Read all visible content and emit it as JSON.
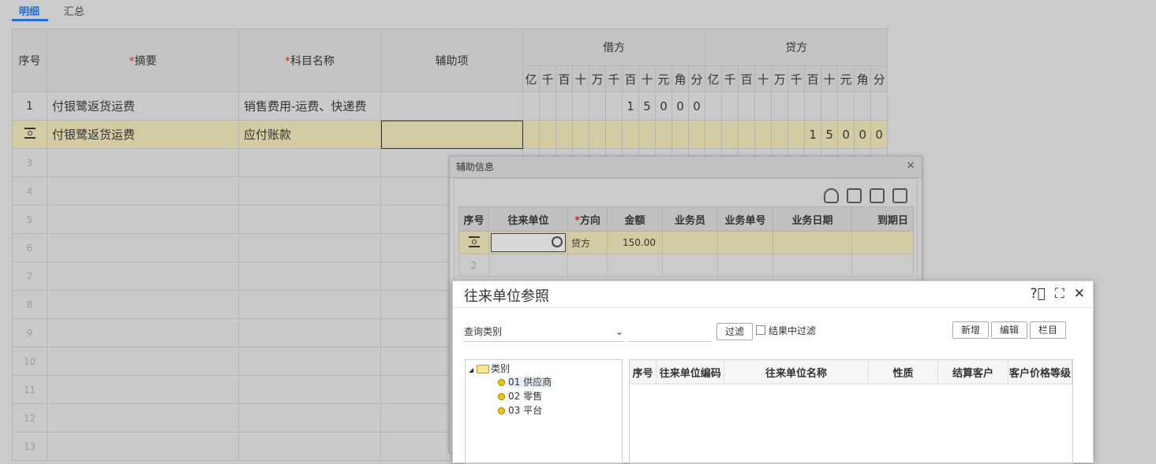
{
  "tabs": [
    {
      "label": "明细",
      "active": true
    },
    {
      "label": "汇总",
      "active": false
    }
  ],
  "main": {
    "headers": {
      "seq": "序号",
      "summary": "摘要",
      "account": "科目名称",
      "aux": "辅助项",
      "debit": "借方",
      "credit": "贷方",
      "required_mark": "*"
    },
    "units": [
      "亿",
      "千",
      "百",
      "十",
      "万",
      "千",
      "百",
      "十",
      "元",
      "角",
      "分"
    ],
    "rows": [
      {
        "seq": "1",
        "summary": "付银鹭返货运费",
        "account": "销售费用-运费、快递费",
        "debit": [
          "",
          "",
          "",
          "",
          "",
          "",
          "1",
          "5",
          "0",
          "0",
          "0"
        ],
        "credit": [
          "",
          "",
          "",
          "",
          "",
          "",
          "",
          "",
          "",
          "",
          ""
        ]
      },
      {
        "seq": "",
        "summary": "付银鹭返货运费",
        "account": "应付账款",
        "debit": [
          "",
          "",
          "",
          "",
          "",
          "",
          "",
          "",
          "",
          "",
          ""
        ],
        "credit": [
          "",
          "",
          "",
          "",
          "",
          "",
          "1",
          "5",
          "0",
          "0",
          "0"
        ]
      }
    ],
    "empty_rows": [
      "3",
      "4",
      "5",
      "6",
      "7",
      "8",
      "9",
      "10",
      "11",
      "12",
      "13"
    ]
  },
  "aux_dialog": {
    "title": "辅助信息",
    "close": "×",
    "headers": [
      "序号",
      "往来单位",
      "方向",
      "金额",
      "业务员",
      "业务单号",
      "业务日期",
      "到期日"
    ],
    "required_mark": "*",
    "rows": [
      {
        "seq": "",
        "unit": "",
        "direction": "贷方",
        "amount": "150.00"
      },
      {
        "seq": "2",
        "unit": "",
        "direction": "",
        "amount": ""
      }
    ]
  },
  "ref_dialog": {
    "title": "往来单位参照",
    "query_type": "查询类别",
    "filter_button": "过滤",
    "filter_in_result": "结果中过滤",
    "buttons": [
      "新增",
      "编辑",
      "栏目"
    ],
    "tree": {
      "root": "类别",
      "items": [
        "01 供应商",
        "02 零售",
        "03 平台"
      ]
    },
    "grid_headers": [
      "序号",
      "往来单位编码",
      "往来单位名称",
      "性质",
      "结算客户",
      "客户价格等级"
    ]
  }
}
